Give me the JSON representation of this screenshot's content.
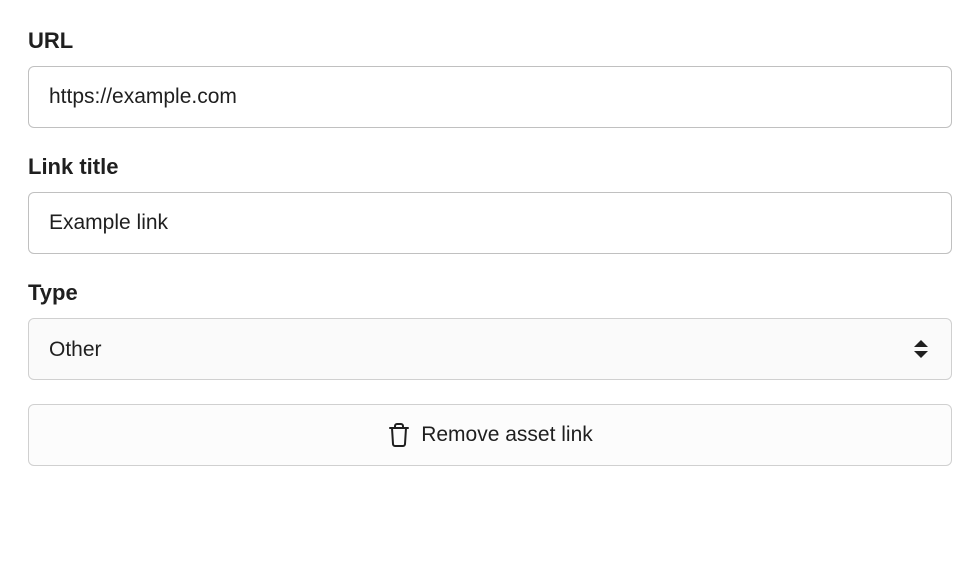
{
  "form": {
    "url": {
      "label": "URL",
      "value": "https://example.com"
    },
    "linkTitle": {
      "label": "Link title",
      "value": "Example link"
    },
    "type": {
      "label": "Type",
      "selected": "Other"
    }
  },
  "actions": {
    "remove": {
      "label": "Remove asset link"
    }
  }
}
